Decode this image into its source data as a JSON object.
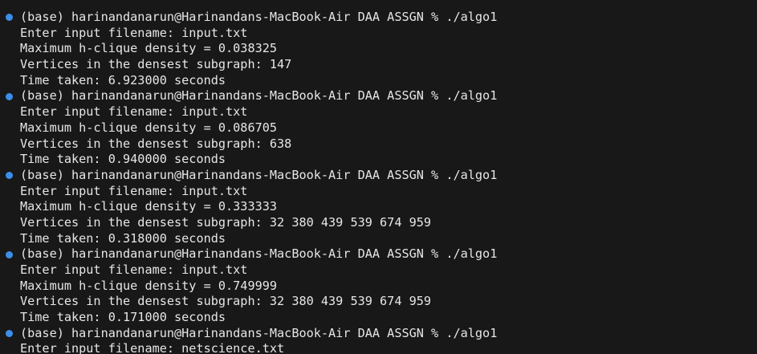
{
  "terminal": {
    "status_dot_color": "#3b8eea",
    "foreground": "#e6e6e6",
    "background": "#181818",
    "lines": [
      {
        "prompt": true,
        "text": "(base) harinandanarun@Harinandans-MacBook-Air DAA ASSGN % ./algo1"
      },
      {
        "prompt": false,
        "text": "Enter input filename: input.txt"
      },
      {
        "prompt": false,
        "text": "Maximum h-clique density = 0.038325"
      },
      {
        "prompt": false,
        "text": "Vertices in the densest subgraph: 147"
      },
      {
        "prompt": false,
        "text": "Time taken: 6.923000 seconds"
      },
      {
        "prompt": true,
        "text": "(base) harinandanarun@Harinandans-MacBook-Air DAA ASSGN % ./algo1"
      },
      {
        "prompt": false,
        "text": "Enter input filename: input.txt"
      },
      {
        "prompt": false,
        "text": "Maximum h-clique density = 0.086705"
      },
      {
        "prompt": false,
        "text": "Vertices in the densest subgraph: 638"
      },
      {
        "prompt": false,
        "text": "Time taken: 0.940000 seconds"
      },
      {
        "prompt": true,
        "text": "(base) harinandanarun@Harinandans-MacBook-Air DAA ASSGN % ./algo1"
      },
      {
        "prompt": false,
        "text": "Enter input filename: input.txt"
      },
      {
        "prompt": false,
        "text": "Maximum h-clique density = 0.333333"
      },
      {
        "prompt": false,
        "text": "Vertices in the densest subgraph: 32 380 439 539 674 959"
      },
      {
        "prompt": false,
        "text": "Time taken: 0.318000 seconds"
      },
      {
        "prompt": true,
        "text": "(base) harinandanarun@Harinandans-MacBook-Air DAA ASSGN % ./algo1"
      },
      {
        "prompt": false,
        "text": "Enter input filename: input.txt"
      },
      {
        "prompt": false,
        "text": "Maximum h-clique density = 0.749999"
      },
      {
        "prompt": false,
        "text": "Vertices in the densest subgraph: 32 380 439 539 674 959"
      },
      {
        "prompt": false,
        "text": "Time taken: 0.171000 seconds"
      },
      {
        "prompt": true,
        "text": "(base) harinandanarun@Harinandans-MacBook-Air DAA ASSGN % ./algo1"
      },
      {
        "prompt": false,
        "text": "Enter input filename: netscience.txt"
      }
    ]
  }
}
